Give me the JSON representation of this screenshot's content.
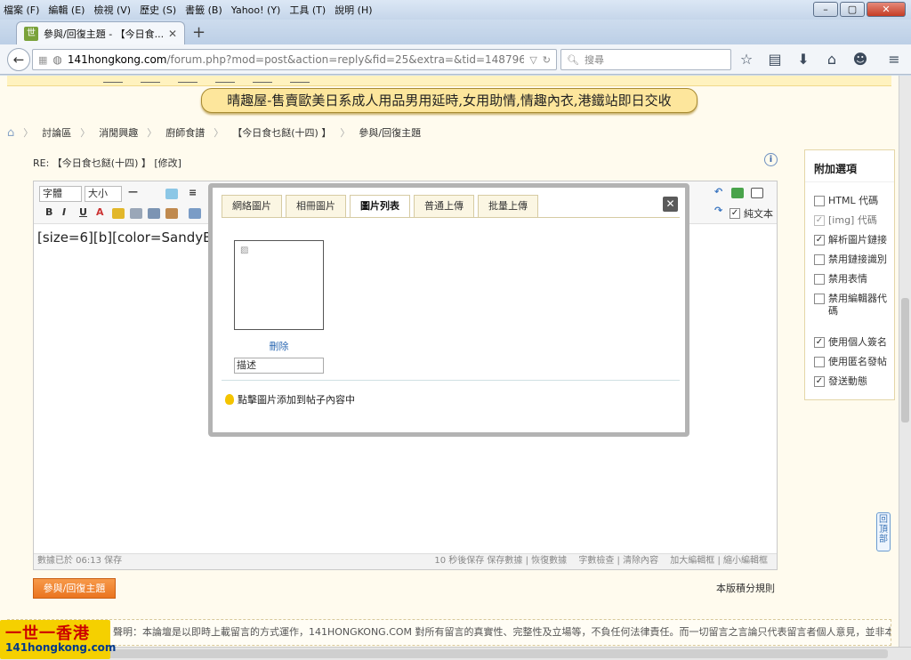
{
  "browser": {
    "menu": [
      "檔案 (F)",
      "編輯 (E)",
      "檢視 (V)",
      "歷史 (S)",
      "書籤 (B)",
      "Yahoo! (Y)",
      "工具 (T)",
      "說明 (H)"
    ],
    "tab_title": "參與/回復主題 - 【今日食...",
    "url_domain": "141hongkong.com",
    "url_path": "/forum.php?mod=post&action=reply&fid=25&extra=&tid=1487969",
    "search_placeholder": "搜尋"
  },
  "page": {
    "banner": "晴趣屋-售賣歐美日系成人用品男用延時,女用助情,情趣內衣,港鐵站即日交收",
    "breadcrumb": [
      "討論區",
      "消閒興趣",
      "廚師食譜",
      "【今日食乜餸(十四) 】",
      "參與/回復主題"
    ],
    "reply_title": "RE: 【今日食乜餸(十四) 】 [修改]",
    "editor": {
      "font_select": "字體",
      "size_select": "大小",
      "plain_text_label": "純文本",
      "content": "[size=6][b][color=SandyBro",
      "status_left": "數據已於 06:13 保存",
      "status_right": [
        "10 秒後保存 保存數據 | 恢復數據",
        "字數檢查 | 清除內容",
        "加大編輯框 | 縮小編輯框"
      ]
    },
    "submit_label": "參與/回復主題",
    "rules_label": "本版積分規則",
    "side_options": {
      "title": "附加選項",
      "items": [
        {
          "label": "HTML 代碼",
          "checked": false
        },
        {
          "label": "[img] 代碼",
          "checked": true
        },
        {
          "label": "解析圖片鏈接",
          "checked": true
        },
        {
          "label": "禁用鏈接識別",
          "checked": false
        },
        {
          "label": "禁用表情",
          "checked": false
        },
        {
          "label": "禁用編輯器代碼",
          "checked": false
        },
        {
          "label": "使用個人簽名",
          "checked": true
        },
        {
          "label": "使用匿名發帖",
          "checked": false
        },
        {
          "label": "發送動態",
          "checked": true
        }
      ]
    },
    "back_to_top": "回頂部",
    "footer_text": "聲明：本論壇是以即時上載留言的方式運作，141HONGKONG.COM 對所有留言的真實性、完整性及立場等，不負任何法律責任。而一切留言之言論只代表留言者個人意見，並非本網站",
    "logo_line1": "一世一香港",
    "logo_line2": "141hongkong.com"
  },
  "modal": {
    "tabs": [
      "網絡圖片",
      "相冊圖片",
      "圖片列表",
      "普通上傳",
      "批量上傳"
    ],
    "active_tab": "圖片列表",
    "delete_label": "刪除",
    "desc_value": "描述",
    "hint": "點擊圖片添加到帖子內容中"
  }
}
